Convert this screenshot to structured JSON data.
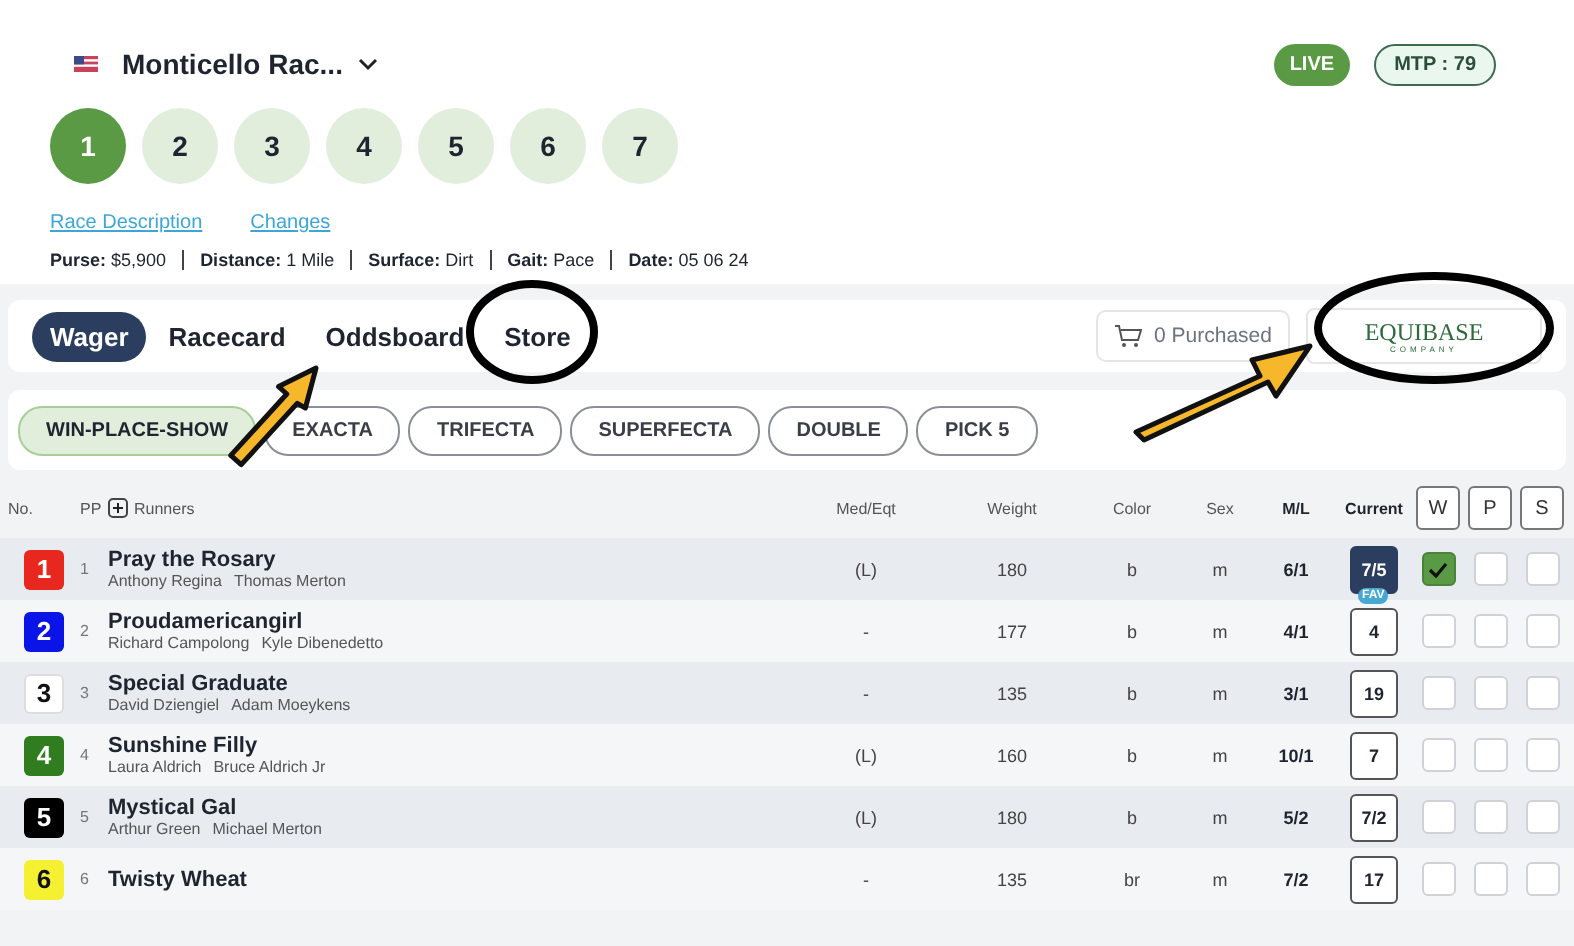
{
  "header": {
    "track_name": "Monticello Rac...",
    "live_badge": "LIVE",
    "mtp_badge": "MTP : 79",
    "races": [
      {
        "label": "1",
        "selected": true
      },
      {
        "label": "2",
        "selected": false
      },
      {
        "label": "3",
        "selected": false
      },
      {
        "label": "4",
        "selected": false
      },
      {
        "label": "5",
        "selected": false
      },
      {
        "label": "6",
        "selected": false
      },
      {
        "label": "7",
        "selected": false
      }
    ],
    "links": [
      "Race Description",
      "Changes"
    ],
    "details": [
      {
        "label": "Purse:",
        "value": "$5,900"
      },
      {
        "label": "Distance:",
        "value": "1 Mile"
      },
      {
        "label": "Surface:",
        "value": "Dirt"
      },
      {
        "label": "Gait:",
        "value": "Pace"
      },
      {
        "label": "Date:",
        "value": "05 06 24"
      }
    ]
  },
  "nav": {
    "tabs": [
      {
        "label": "Wager",
        "selected": true
      },
      {
        "label": "Racecard",
        "selected": false
      },
      {
        "label": "Oddsboard",
        "selected": false
      },
      {
        "label": "Store",
        "selected": false
      }
    ],
    "purchased": "0 Purchased",
    "logo": {
      "text": "EQUIBASE",
      "subtext": "COMPANY"
    }
  },
  "bet_types": [
    {
      "label": "WIN-PLACE-SHOW",
      "selected": true
    },
    {
      "label": "EXACTA",
      "selected": false
    },
    {
      "label": "TRIFECTA",
      "selected": false
    },
    {
      "label": "SUPERFECTA",
      "selected": false
    },
    {
      "label": "DOUBLE",
      "selected": false
    },
    {
      "label": "PICK 5",
      "selected": false
    }
  ],
  "table": {
    "columns": [
      "No.",
      "PP",
      "Runners",
      "Med/Eqt",
      "Weight",
      "Color",
      "Sex",
      "M/L",
      "Current",
      "W",
      "P",
      "S"
    ],
    "rows": [
      {
        "no": "1",
        "color": "#e8281e",
        "pp": "1",
        "name": "Pray the Rosary",
        "people": [
          "Anthony Regina",
          "Thomas Merton"
        ],
        "med": "(L)",
        "weight": "180",
        "horse_color": "b",
        "sex": "m",
        "ml": "6/1",
        "current": "7/5",
        "favorite": true,
        "fav_badge": "FAV",
        "win": true,
        "place": false,
        "show": false
      },
      {
        "no": "2",
        "color": "#0a14e6",
        "pp": "2",
        "name": "Proudamericangirl",
        "people": [
          "Richard Campolong",
          "Kyle Dibenedetto"
        ],
        "med": "-",
        "weight": "177",
        "horse_color": "b",
        "sex": "m",
        "ml": "4/1",
        "current": "4",
        "favorite": false,
        "win": false,
        "place": false,
        "show": false
      },
      {
        "no": "3",
        "color": "#ffffff",
        "pp": "3",
        "name": "Special Graduate",
        "people": [
          "David Dziengiel",
          "Adam Moeykens"
        ],
        "med": "-",
        "weight": "135",
        "horse_color": "b",
        "sex": "m",
        "ml": "3/1",
        "current": "19",
        "favorite": false,
        "win": false,
        "place": false,
        "show": false
      },
      {
        "no": "4",
        "color": "#2f7d1e",
        "pp": "4",
        "name": "Sunshine Filly",
        "people": [
          "Laura Aldrich",
          "Bruce Aldrich Jr"
        ],
        "med": "(L)",
        "weight": "160",
        "horse_color": "b",
        "sex": "m",
        "ml": "10/1",
        "current": "7",
        "favorite": false,
        "win": false,
        "place": false,
        "show": false
      },
      {
        "no": "5",
        "color": "#000000",
        "pp": "5",
        "name": "Mystical Gal",
        "people": [
          "Arthur Green",
          "Michael Merton"
        ],
        "med": "(L)",
        "weight": "180",
        "horse_color": "b",
        "sex": "m",
        "ml": "5/2",
        "current": "7/2",
        "favorite": false,
        "win": false,
        "place": false,
        "show": false
      },
      {
        "no": "6",
        "color": "#f5f032",
        "pp": "6",
        "name": "Twisty Wheat",
        "people": [],
        "med": "-",
        "weight": "135",
        "horse_color": "br",
        "sex": "m",
        "ml": "7/2",
        "current": "17",
        "favorite": false,
        "win": false,
        "place": false,
        "show": false
      }
    ]
  }
}
